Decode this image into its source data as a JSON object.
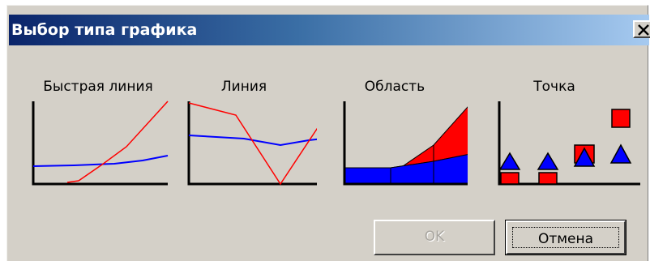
{
  "dialog": {
    "title": "Выбор типа графика",
    "close_glyph": "✕"
  },
  "chart_types": [
    {
      "label": "Быстрая линия",
      "icon": "fast-line-chart-icon"
    },
    {
      "label": "Линия",
      "icon": "line-chart-icon"
    },
    {
      "label": "Область",
      "icon": "area-chart-icon"
    },
    {
      "label": "Точка",
      "icon": "point-chart-icon"
    }
  ],
  "buttons": {
    "ok_label": "OK",
    "ok_enabled": false,
    "cancel_label": "Отмена"
  },
  "colors": {
    "series_red": "#ff0000",
    "series_blue": "#0000ff",
    "axis": "#000000",
    "dialog_bg": "#d4d0c8",
    "title_start": "#0a246a",
    "title_end": "#a6caf0"
  }
}
